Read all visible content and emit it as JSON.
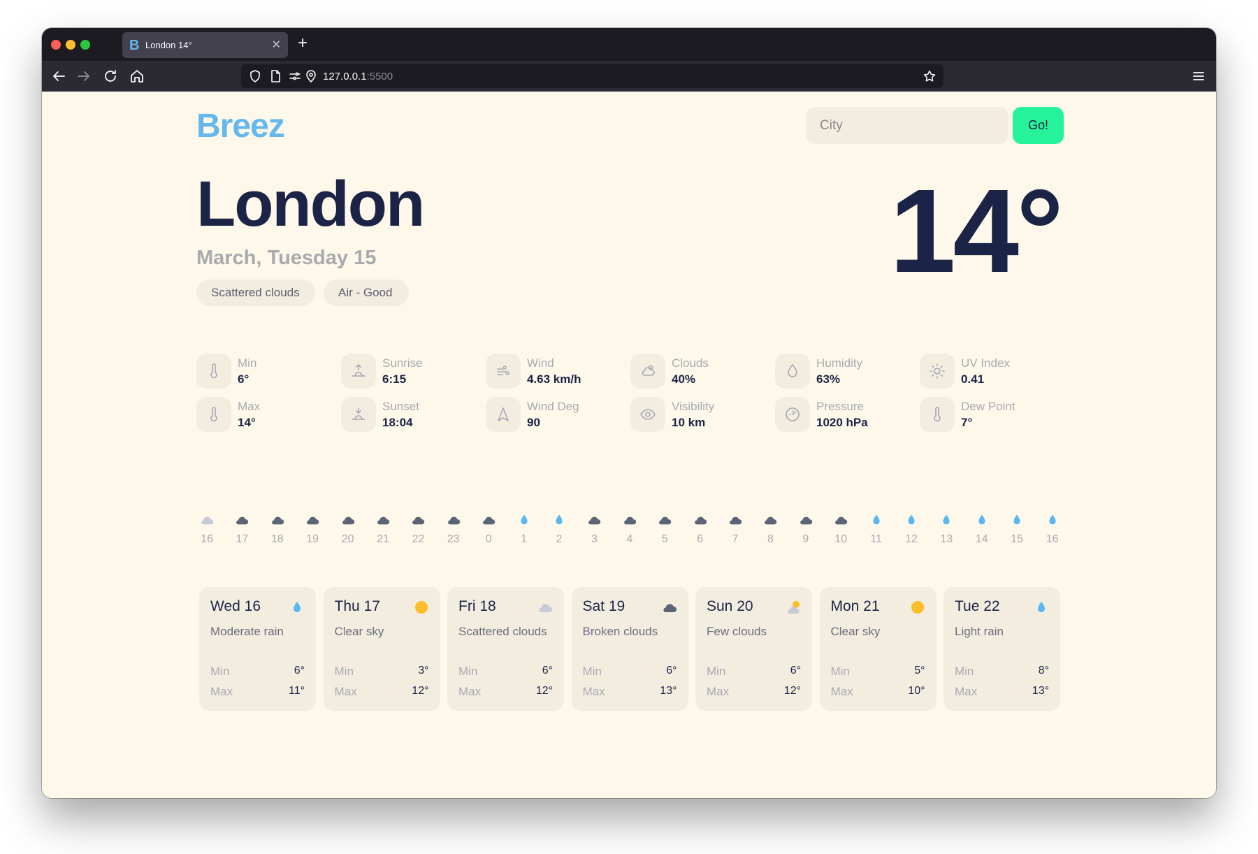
{
  "browser": {
    "tab_title": "London 14°",
    "tab_favicon": "B",
    "url_host": "127.0.0.1",
    "url_port": ":5500"
  },
  "app": {
    "logo": "Breez",
    "search_placeholder": "City",
    "go_label": "Go!",
    "brand_color": "#64b8ee",
    "accent_color": "#26f29a"
  },
  "current": {
    "city": "London",
    "date": "March, Tuesday 15",
    "description": "Scattered clouds",
    "air": "Air - Good",
    "temperature": "14°"
  },
  "stats": [
    {
      "icon": "thermometer-icon",
      "label": "Min",
      "value": "6°"
    },
    {
      "icon": "thermometer-icon",
      "label": "Max",
      "value": "14°"
    },
    {
      "icon": "sunrise-icon",
      "label": "Sunrise",
      "value": "6:15"
    },
    {
      "icon": "sunset-icon",
      "label": "Sunset",
      "value": "18:04"
    },
    {
      "icon": "wind-icon",
      "label": "Wind",
      "value": "4.63 km/h"
    },
    {
      "icon": "navigation-arrow-icon",
      "label": "Wind Deg",
      "value": "90"
    },
    {
      "icon": "cloud-sun-icon",
      "label": "Clouds",
      "value": "40%"
    },
    {
      "icon": "eye-icon",
      "label": "Visibility",
      "value": "10 km"
    },
    {
      "icon": "droplet-icon",
      "label": "Humidity",
      "value": "63%"
    },
    {
      "icon": "gauge-icon",
      "label": "Pressure",
      "value": "1020 hPa"
    },
    {
      "icon": "sun-icon",
      "label": "UV Index",
      "value": "0.41"
    },
    {
      "icon": "thermometer-icon",
      "label": "Dew Point",
      "value": "7°"
    }
  ],
  "hourly": [
    {
      "hour": "16",
      "icon": "light-cloud-icon"
    },
    {
      "hour": "17",
      "icon": "cloud-icon"
    },
    {
      "hour": "18",
      "icon": "cloud-icon"
    },
    {
      "hour": "19",
      "icon": "cloud-icon"
    },
    {
      "hour": "20",
      "icon": "cloud-icon"
    },
    {
      "hour": "21",
      "icon": "cloud-icon"
    },
    {
      "hour": "22",
      "icon": "cloud-icon"
    },
    {
      "hour": "23",
      "icon": "cloud-icon"
    },
    {
      "hour": "0",
      "icon": "cloud-icon"
    },
    {
      "hour": "1",
      "icon": "raindrop-icon"
    },
    {
      "hour": "2",
      "icon": "raindrop-icon"
    },
    {
      "hour": "3",
      "icon": "cloud-icon"
    },
    {
      "hour": "4",
      "icon": "cloud-icon"
    },
    {
      "hour": "5",
      "icon": "cloud-icon"
    },
    {
      "hour": "6",
      "icon": "cloud-icon"
    },
    {
      "hour": "7",
      "icon": "cloud-icon"
    },
    {
      "hour": "8",
      "icon": "cloud-icon"
    },
    {
      "hour": "9",
      "icon": "cloud-icon"
    },
    {
      "hour": "10",
      "icon": "cloud-icon"
    },
    {
      "hour": "11",
      "icon": "raindrop-icon"
    },
    {
      "hour": "12",
      "icon": "raindrop-icon"
    },
    {
      "hour": "13",
      "icon": "raindrop-icon"
    },
    {
      "hour": "14",
      "icon": "raindrop-icon"
    },
    {
      "hour": "15",
      "icon": "raindrop-icon"
    },
    {
      "hour": "16",
      "icon": "raindrop-icon"
    }
  ],
  "daily": [
    {
      "day": "Wed 16",
      "icon": "raindrop-icon",
      "desc": "Moderate rain",
      "min_label": "Min",
      "min": "6°",
      "max_label": "Max",
      "max": "11°"
    },
    {
      "day": "Thu 17",
      "icon": "sun-icon",
      "desc": "Clear sky",
      "min_label": "Min",
      "min": "3°",
      "max_label": "Max",
      "max": "12°"
    },
    {
      "day": "Fri 18",
      "icon": "light-cloud-icon",
      "desc": "Scattered clouds",
      "min_label": "Min",
      "min": "6°",
      "max_label": "Max",
      "max": "12°"
    },
    {
      "day": "Sat 19",
      "icon": "cloud-icon",
      "desc": "Broken clouds",
      "min_label": "Min",
      "min": "6°",
      "max_label": "Max",
      "max": "13°"
    },
    {
      "day": "Sun 20",
      "icon": "cloud-sun-icon",
      "desc": "Few clouds",
      "min_label": "Min",
      "min": "6°",
      "max_label": "Max",
      "max": "12°"
    },
    {
      "day": "Mon 21",
      "icon": "sun-icon",
      "desc": "Clear sky",
      "min_label": "Min",
      "min": "5°",
      "max_label": "Max",
      "max": "10°"
    },
    {
      "day": "Tue 22",
      "icon": "raindrop-icon",
      "desc": "Light rain",
      "min_label": "Min",
      "min": "8°",
      "max_label": "Max",
      "max": "13°"
    }
  ]
}
